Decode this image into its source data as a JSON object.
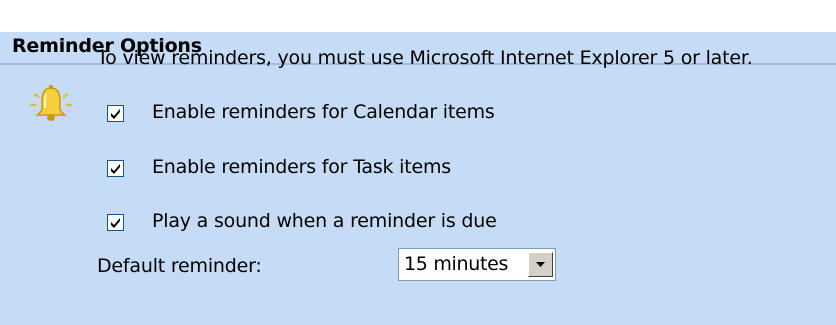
{
  "section": {
    "title": "Reminder Options"
  },
  "info_text": "To view reminders, you must use Microsoft Internet Explorer 5 or later.",
  "options": [
    {
      "label": "Enable reminders for Calendar items",
      "checked": true
    },
    {
      "label": "Enable reminders for Task items",
      "checked": true
    },
    {
      "label": "Play a sound when a reminder is due",
      "checked": true
    }
  ],
  "default_reminder": {
    "label": "Default reminder:",
    "value": "15 minutes"
  },
  "icons": {
    "bell": "reminder-bell-icon",
    "dropdown": "dropdown-arrow-icon",
    "check": "checkmark-icon"
  },
  "colors": {
    "panel_bg": "#c6dbf5",
    "header_line": "#9fbce6",
    "bell": "#f2c630"
  }
}
